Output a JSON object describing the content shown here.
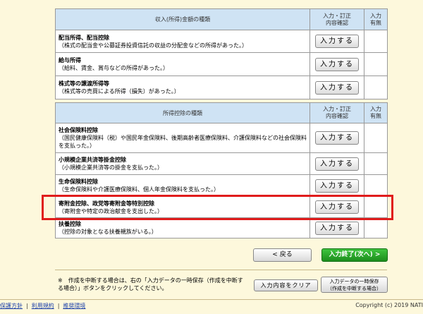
{
  "income_table": {
    "headers": {
      "type": "収入(所得)金額の種類",
      "input_line1": "入力・訂正",
      "input_line2": "内容確認",
      "exists_line1": "入力",
      "exists_line2": "有無"
    },
    "rows": [
      {
        "title": "配当所得、配当控除",
        "desc": "（株式の配当金や公募証券投資信託の収益の分配金などの所得があった。）",
        "button": "入力する"
      },
      {
        "title": "給与所得",
        "desc": "（給料、賃金、賞与などの所得があった。）",
        "button": "入力する"
      },
      {
        "title": "株式等の譲渡所得等",
        "desc": "（株式等の売買による所得（損失）があった。）",
        "button": "入力する"
      }
    ]
  },
  "deduction_table": {
    "headers": {
      "type": "所得控除の種類",
      "input_line1": "入力・訂正",
      "input_line2": "内容確認",
      "exists_line1": "入力",
      "exists_line2": "有無"
    },
    "rows": [
      {
        "title": "社会保険料控除",
        "desc": "（国民健康保険料（税）や国民年金保険料、後期高齢者医療保険料、介護保険料などの社会保険料を支払った。）",
        "button": "入力する"
      },
      {
        "title": "小規模企業共済等掛金控除",
        "desc": "（小規模企業共済等の掛金を支払った。）",
        "button": "入力する"
      },
      {
        "title": "生命保険料控除",
        "desc": "（生命保険料や介護医療保険料、個人年金保険料を支払った。）",
        "button": "入力する"
      },
      {
        "title": "寄附金控除、政党等寄附金等特別控除",
        "desc": "（寄附金や特定の政治献金を支出した。）",
        "button": "入力する"
      },
      {
        "title": "扶養控除",
        "desc": "（控除の対象となる扶養親族がいる。）",
        "button": "入力する"
      }
    ]
  },
  "nav": {
    "back": "< 戻る",
    "next": "入力終了(次へ) >"
  },
  "bottom": {
    "note_mark": "※",
    "note": "作成を中断する場合は、右の「入力データの一時保存（作成を中断する場合）」ボタンをクリックしてください。",
    "clear_button": "入力内容をクリア",
    "save_line1": "入力データの一時保存",
    "save_line2": "（作成を中断する場合）"
  },
  "footer": {
    "links": [
      "保護方針",
      "利用規約",
      "推奨環境"
    ],
    "copyright": "Copyright (c) 2019 NATI"
  },
  "colors": {
    "highlight": "#e01c1c",
    "header_bg": "#cfe3f4",
    "page_bg": "#fdf8dc",
    "next_button": "#1c8d1c"
  }
}
